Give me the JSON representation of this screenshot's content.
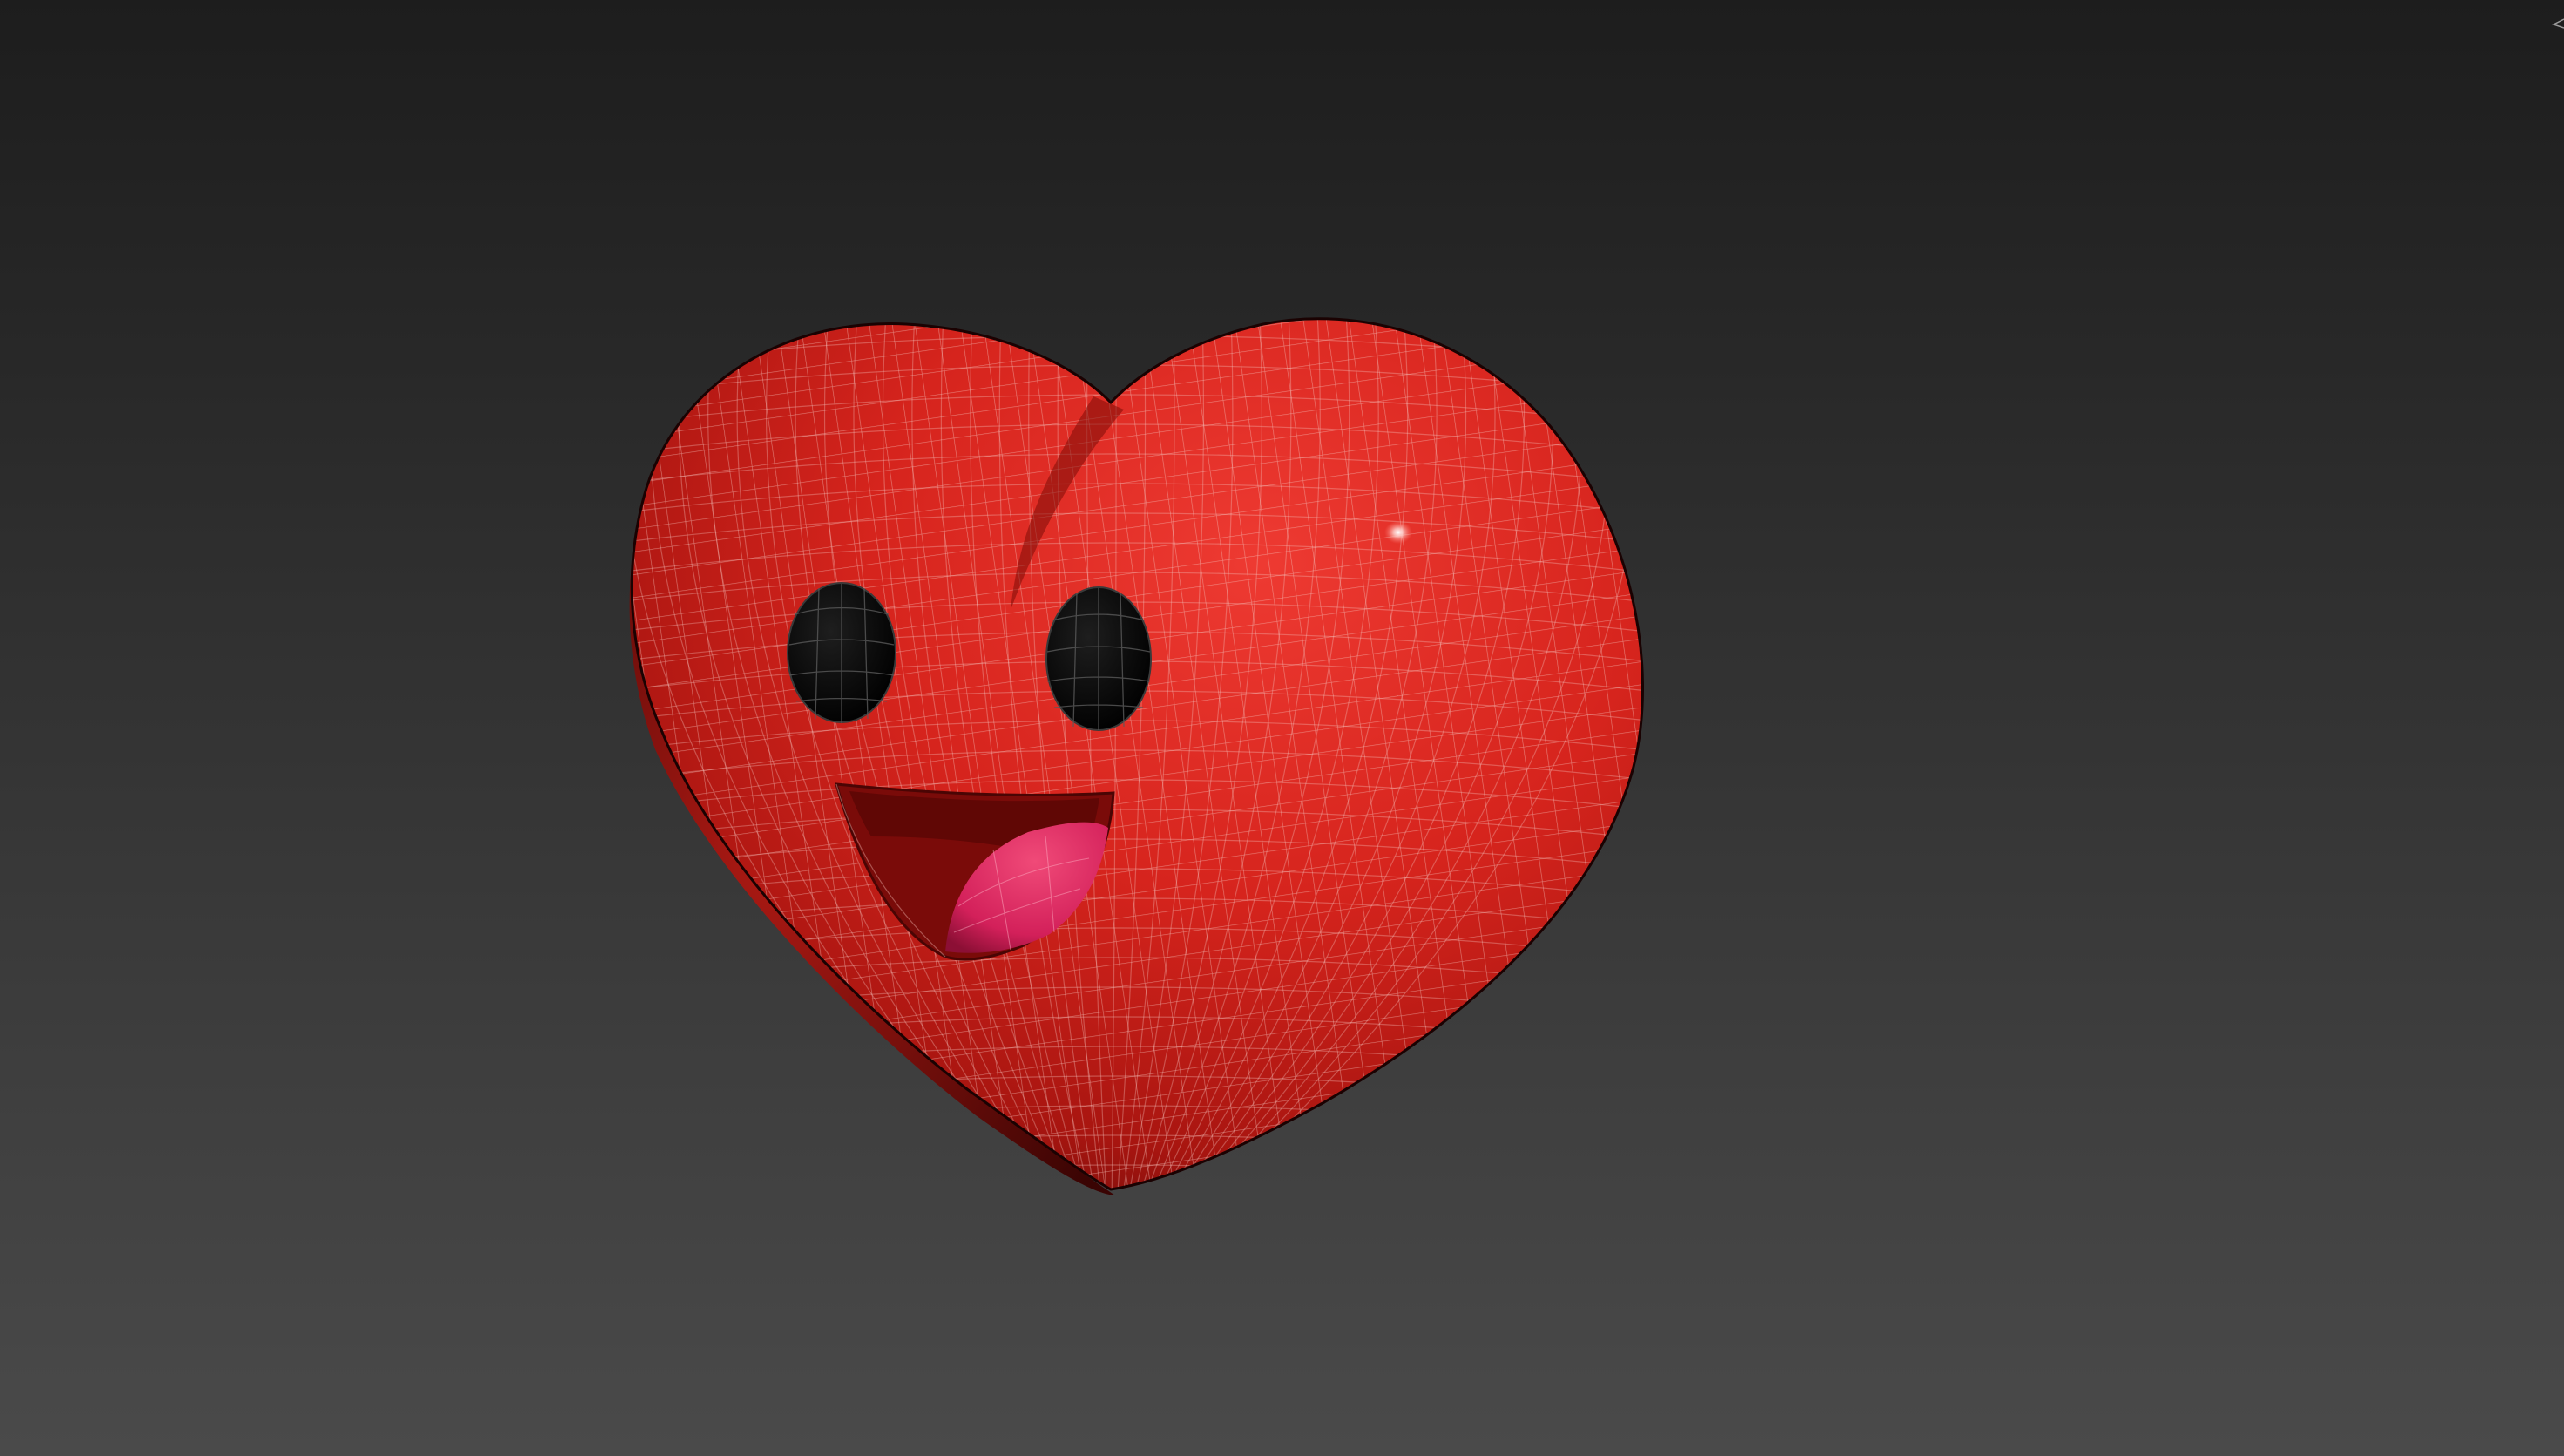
{
  "viewport": {
    "background_top": "#1d1d1d",
    "background_bottom": "#4a4a4a"
  },
  "model": {
    "name": "heart-character",
    "body_color": "#d8261f",
    "wire_color": "#f2b8b0",
    "eye_color": "#0b0b0b",
    "mouth_color": "#8e0f0d",
    "tongue_color": "#e02a5e",
    "display_mode": "smooth-shaded-with-wireframe"
  },
  "icons": {
    "viewcube": "viewcube-corner-icon"
  }
}
